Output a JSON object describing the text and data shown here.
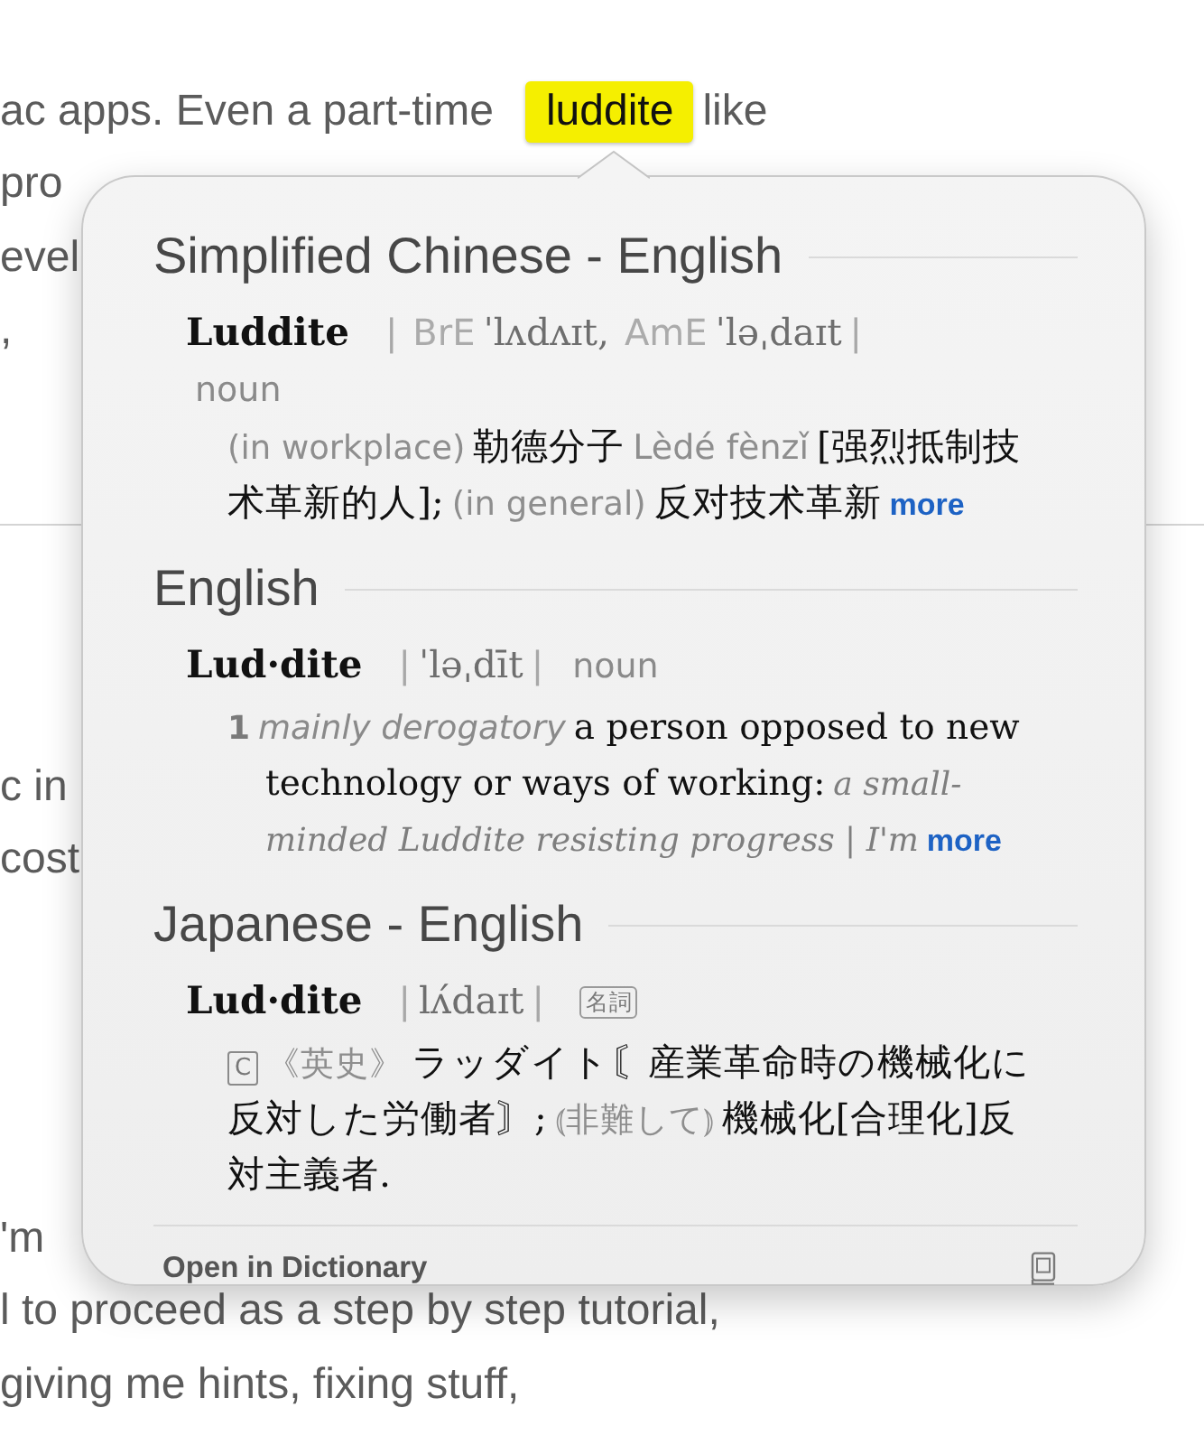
{
  "document": {
    "sections": [
      {
        "divider": true,
        "lines": [
          {
            "parts": [
              {
                "text": "ac apps. Even a part-time",
                "highlighted": false
              },
              {
                "text": "luddite",
                "highlighted": true
              },
              {
                "text": "like",
                "highlighted": false
              }
            ]
          },
          {
            "parts": [
              {
                "text": "pro",
                "highlighted": false
              }
            ]
          },
          {
            "parts": [
              {
                "text": "evel",
                "highlighted": false
              }
            ]
          },
          {
            "parts": [
              {
                "text": ",",
                "highlighted": false
              }
            ]
          }
        ]
      },
      {
        "divider": false,
        "lines": [
          {
            "parts": [
              {
                "text": "c in",
                "highlighted": false
              }
            ]
          },
          {
            "parts": [
              {
                "text": "cost",
                "highlighted": false
              }
            ]
          }
        ]
      },
      {
        "divider": false,
        "lines": [
          {
            "parts": [
              {
                "text": "'m",
                "highlighted": false
              }
            ]
          },
          {
            "parts": [
              {
                "text": "l to proceed as a step by step tutorial,",
                "highlighted": false
              }
            ]
          },
          {
            "parts": [
              {
                "text": "giving me hints, fixing stuff,",
                "highlighted": false
              }
            ]
          }
        ]
      }
    ]
  },
  "popover": {
    "sections": [
      {
        "title": "Simplified Chinese - English",
        "entries": [
          {
            "headword": "Luddite",
            "pronunciation": [
              {
                "kind": "bar",
                "text": "|"
              },
              {
                "kind": "label",
                "text": "BrE"
              },
              {
                "kind": "ipa",
                "text": "ˈlʌdʌɪt,"
              },
              {
                "kind": "label",
                "text": "AmE"
              },
              {
                "kind": "ipa",
                "text": "ˈləˌdaɪt"
              },
              {
                "kind": "bar",
                "text": "|"
              }
            ],
            "part_of_speech": {
              "kind": "line",
              "text": "noun"
            },
            "senses": [
              {
                "segments": [
                  {
                    "kind": "label",
                    "text": "(in workplace)"
                  },
                  {
                    "kind": "term",
                    "text": "勒德分子"
                  },
                  {
                    "kind": "pinyin",
                    "text": "Lèdé fènzǐ"
                  },
                  {
                    "kind": "term",
                    "text": "[强烈抵制技术革新的人];"
                  },
                  {
                    "kind": "label",
                    "text": "(in general)"
                  },
                  {
                    "kind": "term",
                    "text": "反对技术革新"
                  }
                ],
                "more": "more"
              }
            ]
          }
        ]
      },
      {
        "title": "English",
        "entries": [
          {
            "headword": "Lud·dite",
            "pronunciation": [
              {
                "kind": "bar",
                "text": "|"
              },
              {
                "kind": "ipa",
                "text": "ˈləˌdīt"
              },
              {
                "kind": "bar",
                "text": "|"
              }
            ],
            "part_of_speech": {
              "kind": "inline",
              "text": "noun"
            },
            "senses": [
              {
                "number": "1",
                "segments": [
                  {
                    "kind": "register",
                    "text": "mainly derogatory"
                  },
                  {
                    "kind": "gloss",
                    "text": "a person opposed to new technology or ways of working:"
                  },
                  {
                    "kind": "example",
                    "text": "a small-minded Luddite resisting progress | I'm"
                  }
                ],
                "more": "more"
              }
            ]
          }
        ]
      },
      {
        "title": "Japanese - English",
        "entries": [
          {
            "headword": "Lud·dite",
            "pronunciation": [
              {
                "kind": "bar",
                "text": "|"
              },
              {
                "kind": "ipa",
                "text": "lʌ́daɪt"
              },
              {
                "kind": "bar",
                "text": "|"
              }
            ],
            "part_of_speech": {
              "kind": "boxed",
              "text": "名詞"
            },
            "senses": [
              {
                "segments": [
                  {
                    "kind": "tag",
                    "text": "C"
                  },
                  {
                    "kind": "label",
                    "text": "《英史》"
                  },
                  {
                    "kind": "term",
                    "text": "ラッダイト〘産業革命時の機械化に反対した労働者〙;"
                  },
                  {
                    "kind": "label",
                    "text": "⦅非難して⦆"
                  },
                  {
                    "kind": "term",
                    "text": "機械化[合理化]反対主義者."
                  }
                ]
              }
            ]
          }
        ]
      }
    ],
    "footer": {
      "link": "Open in Dictionary"
    }
  }
}
